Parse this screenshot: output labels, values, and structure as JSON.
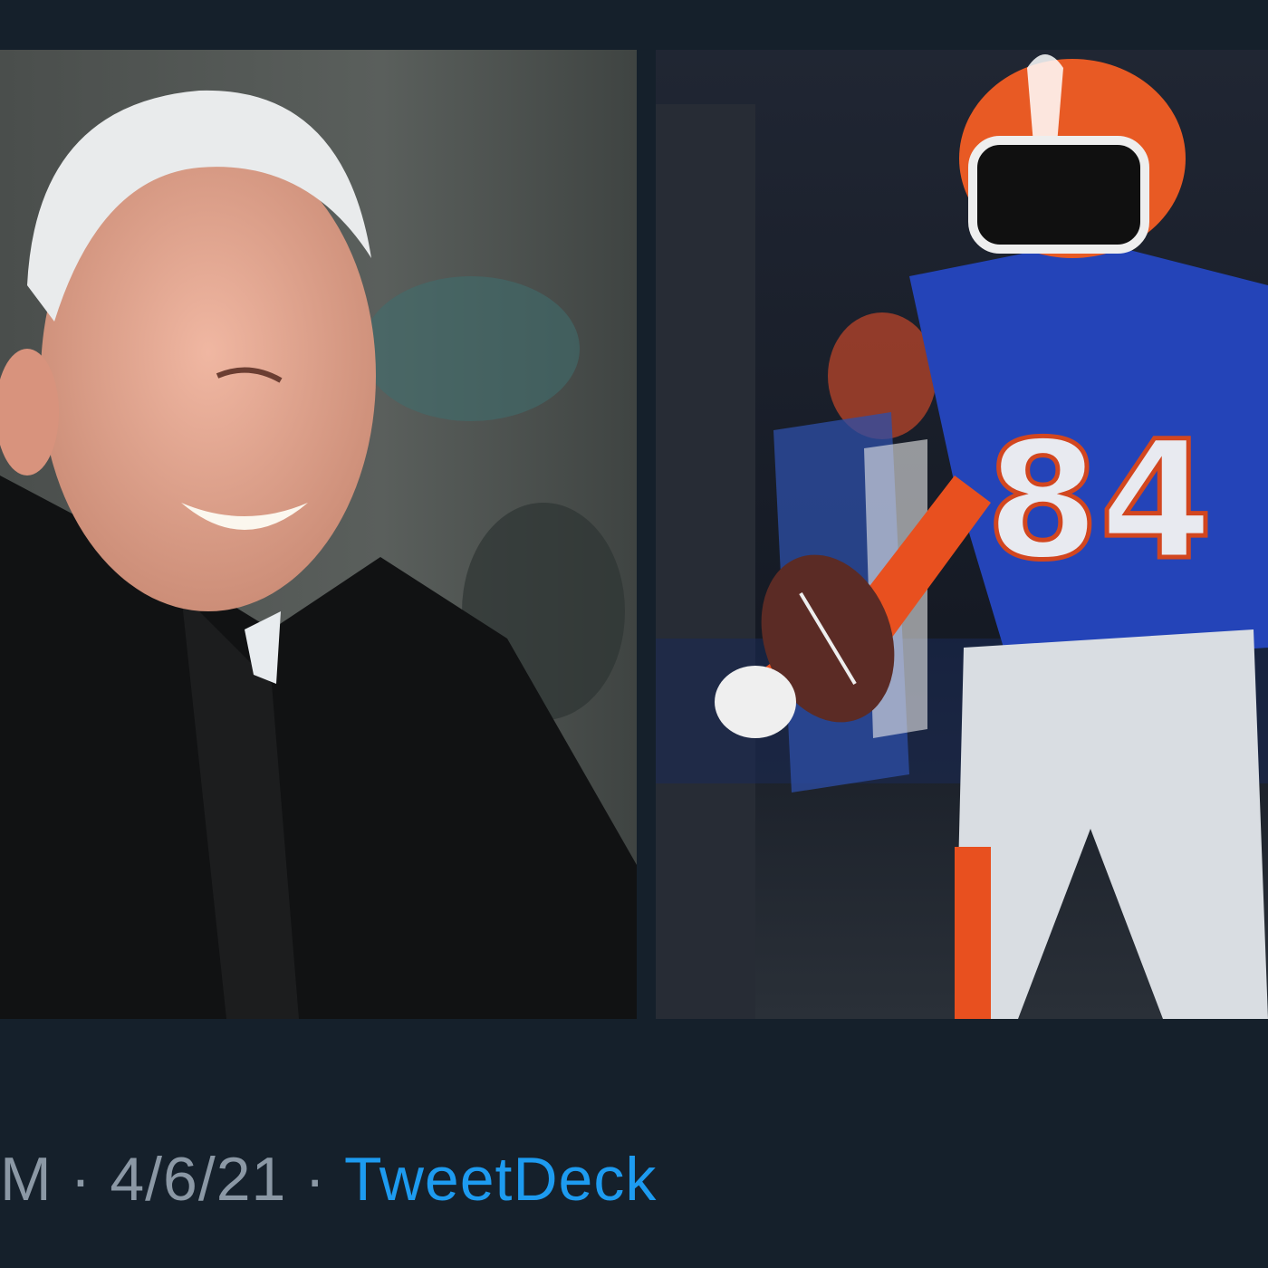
{
  "tweet": {
    "media": [
      {
        "description_icon": "photo-smiling-man-in-black-coat"
      },
      {
        "description_icon": "photo-football-player-84"
      }
    ],
    "time_fragment": "M",
    "separator": "·",
    "date": "4/6/21",
    "source": "TweetDeck"
  },
  "colors": {
    "background": "#15202b",
    "meta_text": "#8b98a5",
    "link": "#1d9bf0"
  }
}
